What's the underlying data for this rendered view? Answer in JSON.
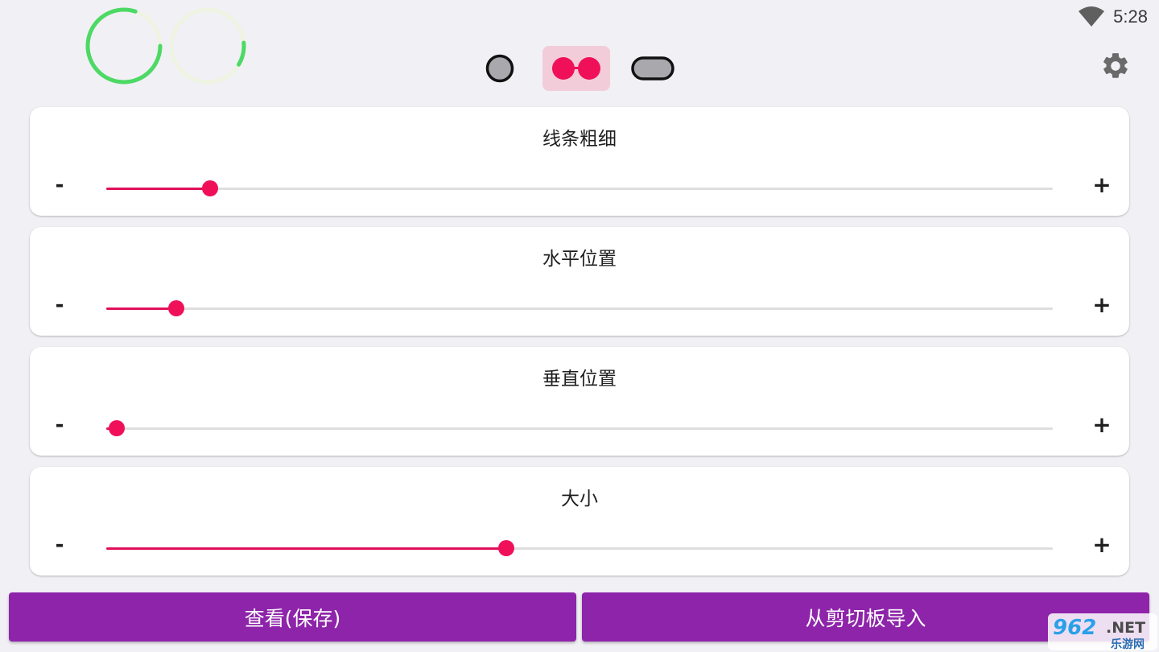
{
  "status_bar": {
    "time": "5:28",
    "wifi_icon": "wifi-icon"
  },
  "progress_rings": [
    {
      "name": "ring-left",
      "fraction": 0.8,
      "color": "#4cd964"
    },
    {
      "name": "ring-right",
      "fraction": 0.1,
      "color": "#4cd964"
    }
  ],
  "style_options": [
    {
      "name": "single-dot-style",
      "selected": false
    },
    {
      "name": "double-dot-style",
      "selected": true
    },
    {
      "name": "pill-style",
      "selected": false
    }
  ],
  "colors": {
    "accent": "#f0105a",
    "button": "#8e24aa",
    "selected_bg": "#f2cdd9"
  },
  "sliders": [
    {
      "label": "线条粗细",
      "value": 0.11,
      "minus": "-",
      "plus": "+"
    },
    {
      "label": "水平位置",
      "value": 0.074,
      "minus": "-",
      "plus": "+"
    },
    {
      "label": "垂直位置",
      "value": 0.011,
      "minus": "-",
      "plus": "+"
    },
    {
      "label": "大小",
      "value": 0.423,
      "minus": "-",
      "plus": "+"
    }
  ],
  "buttons": {
    "view_save": "查看(保存)",
    "import_clipboard": "从剪切板导入"
  },
  "watermark": {
    "brand": "962",
    "domain": ".NET",
    "subtitle": "乐游网"
  }
}
